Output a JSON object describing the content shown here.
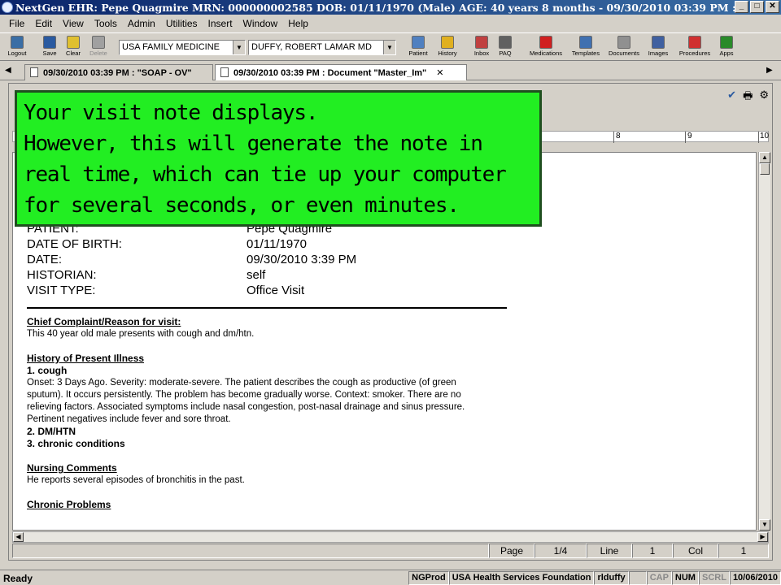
{
  "window": {
    "title": "NextGen EHR: Pepe Quagmire  MRN: 000000002585  DOB: 01/11/1970  (Male)  AGE: 40 years 8 months - 09/30/2010 03:39 PM  : Documen...",
    "minimize": "_",
    "maximize": "□",
    "close": "✕"
  },
  "menu": [
    "File",
    "Edit",
    "View",
    "Tools",
    "Admin",
    "Utilities",
    "Insert",
    "Window",
    "Help"
  ],
  "toolbar": {
    "left_buttons": [
      {
        "label": "Logout",
        "icon": "logout-icon",
        "color": "#3a6ea5"
      },
      {
        "label": "Save",
        "icon": "save-icon",
        "color": "#2a5aa0"
      },
      {
        "label": "Clear",
        "icon": "clear-icon",
        "color": "#e0c030"
      },
      {
        "label": "Delete",
        "icon": "delete-icon",
        "color": "#a0a0a0"
      }
    ],
    "practice": "USA FAMILY MEDICINE",
    "provider": "DUFFY, ROBERT  LAMAR MD",
    "right_buttons": [
      {
        "label": "Patient",
        "icon": "patient-icon",
        "color": "#5080c0"
      },
      {
        "label": "History",
        "icon": "history-icon",
        "color": "#e0b020"
      },
      {
        "label": "Inbox",
        "icon": "inbox-icon",
        "color": "#c04040"
      },
      {
        "label": "PAQ",
        "icon": "paq-icon",
        "color": "#606060"
      },
      {
        "label": "Medications",
        "icon": "medications-icon",
        "color": "#d02020"
      },
      {
        "label": "Templates",
        "icon": "templates-icon",
        "color": "#4070b0"
      },
      {
        "label": "Documents",
        "icon": "documents-icon",
        "color": "#909090"
      },
      {
        "label": "Images",
        "icon": "images-icon",
        "color": "#4060a0"
      },
      {
        "label": "Procedures",
        "icon": "procedures-icon",
        "color": "#d03030"
      },
      {
        "label": "Apps",
        "icon": "apps-icon",
        "color": "#2a8a2a"
      }
    ]
  },
  "tabs": [
    {
      "label": "09/30/2010 03:39 PM : \"SOAP - OV\"",
      "active": false
    },
    {
      "label": "09/30/2010 03:39 PM : Document \"Master_Im\"",
      "active": true
    }
  ],
  "ruler": [
    "8",
    "9",
    "10"
  ],
  "document": {
    "header": [
      {
        "k": "PATIENT:",
        "v": "Pepe Quagmire"
      },
      {
        "k": "DATE OF BIRTH:",
        "v": "01/11/1970"
      },
      {
        "k": "DATE:",
        "v": "09/30/2010 3:39 PM"
      },
      {
        "k": "HISTORIAN:",
        "v": "self"
      },
      {
        "k": "VISIT TYPE:",
        "v": "Office Visit"
      }
    ],
    "chief_complaint_title": "Chief Complaint/Reason for visit:",
    "chief_complaint": "This 40 year old male presents with cough and dm/htn.",
    "hpi_title": "History of Present Illness",
    "hpi_item1": "1.  cough",
    "hpi_item1_text": "Onset: 3 Days Ago.  Severity: moderate-severe.  The patient describes the cough as productive (of green sputum).  It occurs persistently.  The problem has become gradually worse.  Context: smoker.  There are no relieving factors.  Associated symptoms include nasal congestion, post-nasal drainage and sinus pressure.  Pertinent negatives include fever and sore throat.",
    "hpi_item2": "2.  DM/HTN",
    "hpi_item3": "3.  chronic conditions",
    "nursing_title": "Nursing Comments",
    "nursing_text": "He reports several episodes of bronchitis in the past.",
    "chronic_title": "Chronic Problems"
  },
  "doc_status": {
    "page_label": "Page",
    "page_value": "1/4",
    "line_label": "Line",
    "line_value": "1",
    "col_label": "Col",
    "col_value": "1"
  },
  "callout": {
    "lines": [
      "Your visit note displays.",
      "However, this will generate the note in",
      "real time, which can tie up your computer",
      "for several seconds, or even minutes."
    ],
    "color": "#22ee22"
  },
  "status": {
    "ready": "Ready",
    "cells": [
      "NGProd",
      "USA Health Services Foundation",
      "rlduffy",
      "",
      "CAP",
      "NUM",
      "SCRL",
      "10/06/2010"
    ]
  }
}
